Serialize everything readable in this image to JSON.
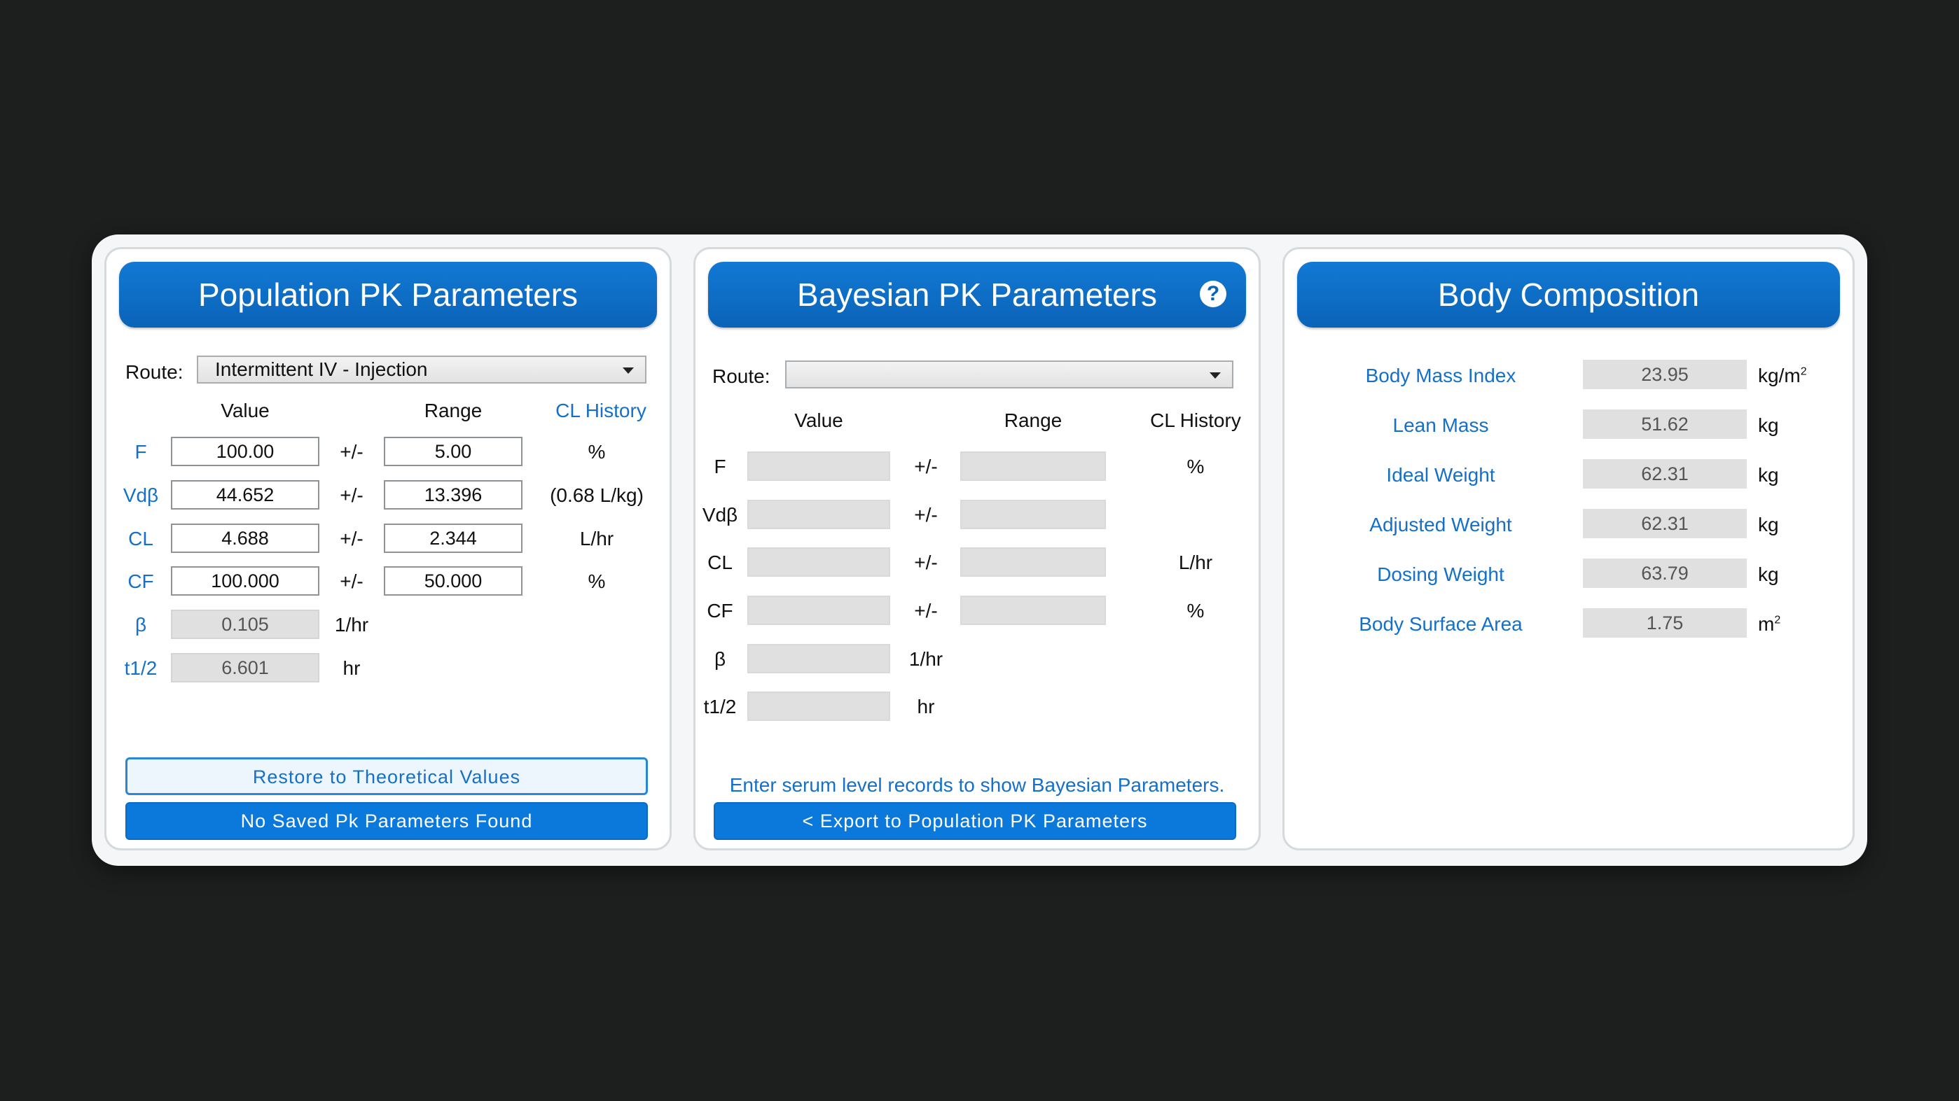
{
  "population": {
    "title": "Population PK Parameters",
    "route_label": "Route:",
    "route_value": "Intermittent IV - Injection",
    "col_value": "Value",
    "col_range": "Range",
    "col_history": "CL History",
    "pm": "+/-",
    "rows": [
      {
        "param": "F",
        "value": "100.00",
        "range": "5.00",
        "unit": "%"
      },
      {
        "param": "Vdβ",
        "value": "44.652",
        "range": "13.396",
        "unit": "(0.68 L/kg)"
      },
      {
        "param": "CL",
        "value": "4.688",
        "range": "2.344",
        "unit": "L/hr"
      },
      {
        "param": "CF",
        "value": "100.000",
        "range": "50.000",
        "unit": "%"
      },
      {
        "param": "β",
        "value": "0.105",
        "unit": "1/hr"
      },
      {
        "param": "t1/2",
        "value": "6.601",
        "unit": "hr"
      }
    ],
    "restore_button": "Restore to Theoretical Values",
    "saved_button": "No Saved Pk Parameters Found"
  },
  "bayesian": {
    "title": "Bayesian PK Parameters",
    "help_icon": "?",
    "route_label": "Route:",
    "route_value": "",
    "col_value": "Value",
    "col_range": "Range",
    "col_history": "CL History",
    "pm": "+/-",
    "rows": [
      {
        "param": "F",
        "unit": "%"
      },
      {
        "param": "Vdβ",
        "unit": ""
      },
      {
        "param": "CL",
        "unit": "L/hr"
      },
      {
        "param": "CF",
        "unit": "%"
      },
      {
        "param": "β",
        "unit": "1/hr"
      },
      {
        "param": "t1/2",
        "unit": "hr"
      }
    ],
    "hint": "Enter serum level records to show Bayesian Parameters.",
    "export_button": "< Export to Population PK Parameters"
  },
  "body": {
    "title": "Body Composition",
    "rows": [
      {
        "name": "Body Mass Index",
        "value": "23.95",
        "unit": "kg/m",
        "sup": "2"
      },
      {
        "name": "Lean Mass",
        "value": "51.62",
        "unit": "kg",
        "sup": ""
      },
      {
        "name": "Ideal Weight",
        "value": "62.31",
        "unit": "kg",
        "sup": ""
      },
      {
        "name": "Adjusted Weight",
        "value": "62.31",
        "unit": "kg",
        "sup": ""
      },
      {
        "name": "Dosing Weight",
        "value": "63.79",
        "unit": "kg",
        "sup": ""
      },
      {
        "name": "Body Surface Area",
        "value": "1.75",
        "unit": "m",
        "sup": "2"
      }
    ]
  }
}
